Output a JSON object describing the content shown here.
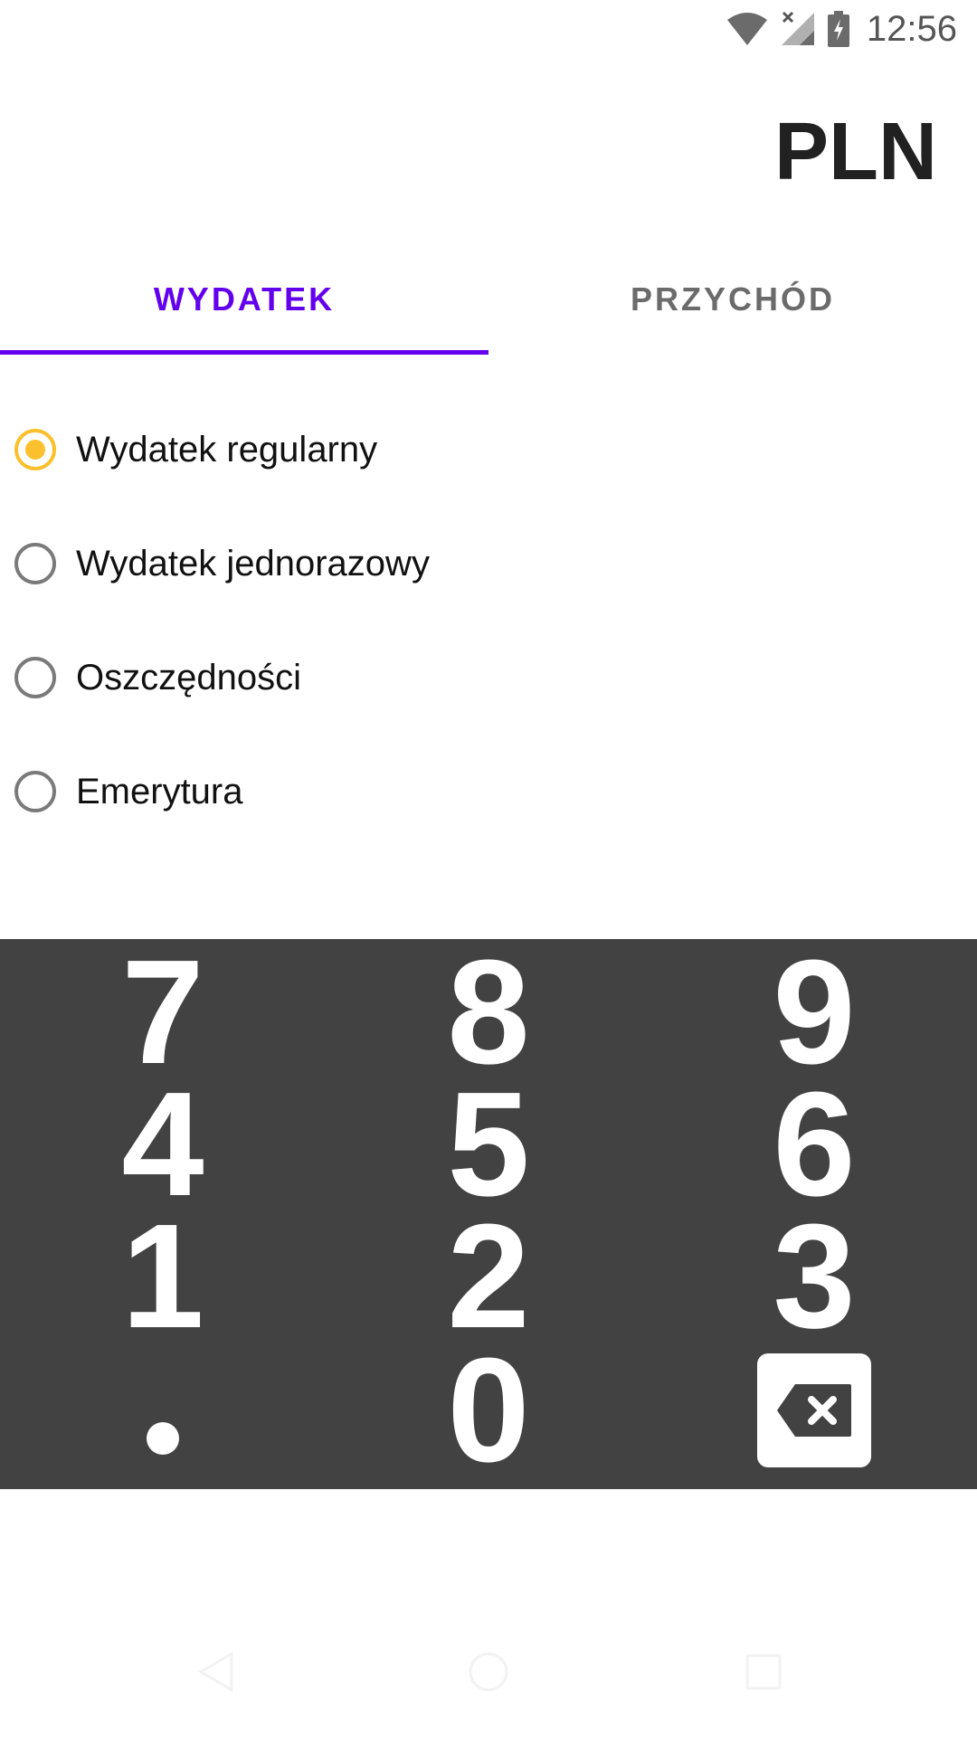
{
  "status_bar": {
    "time": "12:56",
    "icons": [
      "wifi-icon",
      "signal-no-service-icon",
      "battery-charging-icon"
    ]
  },
  "header": {
    "currency": "PLN"
  },
  "tabs": [
    {
      "label": "WYDATEK",
      "active": true
    },
    {
      "label": "PRZYCHÓD",
      "active": false
    }
  ],
  "options": [
    {
      "label": "Wydatek regularny",
      "checked": true
    },
    {
      "label": "Wydatek jednorazowy",
      "checked": false
    },
    {
      "label": "Oszczędności",
      "checked": false
    },
    {
      "label": "Emerytura",
      "checked": false
    }
  ],
  "keypad": {
    "keys": [
      "7",
      "8",
      "9",
      "4",
      "5",
      "6",
      "1",
      "2",
      "3",
      ".",
      "0",
      "backspace-icon"
    ]
  },
  "nav": {
    "icons": [
      "back-icon",
      "home-icon",
      "recents-icon"
    ]
  },
  "colors": {
    "accent": "#6200ee",
    "radio_selected": "#fbc02d",
    "keypad_bg": "#424242"
  }
}
